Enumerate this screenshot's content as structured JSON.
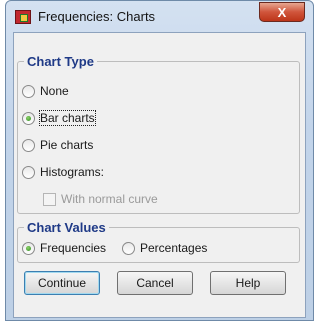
{
  "window": {
    "title": "Frequencies: Charts",
    "close_label": "X"
  },
  "chart_type": {
    "legend": "Chart Type",
    "options": [
      {
        "label": "None",
        "selected": false
      },
      {
        "label": "Bar charts",
        "selected": true
      },
      {
        "label": "Pie charts",
        "selected": false
      },
      {
        "label": "Histograms:",
        "selected": false
      }
    ],
    "normal_curve": {
      "label": "With normal curve",
      "checked": false,
      "enabled": false
    }
  },
  "chart_values": {
    "legend": "Chart Values",
    "options": [
      {
        "label": "Frequencies",
        "selected": true
      },
      {
        "label": "Percentages",
        "selected": false
      }
    ]
  },
  "buttons": {
    "continue": "Continue",
    "cancel": "Cancel",
    "help": "Help"
  },
  "icons": {
    "app": "spss-app-icon",
    "close": "close-icon"
  }
}
